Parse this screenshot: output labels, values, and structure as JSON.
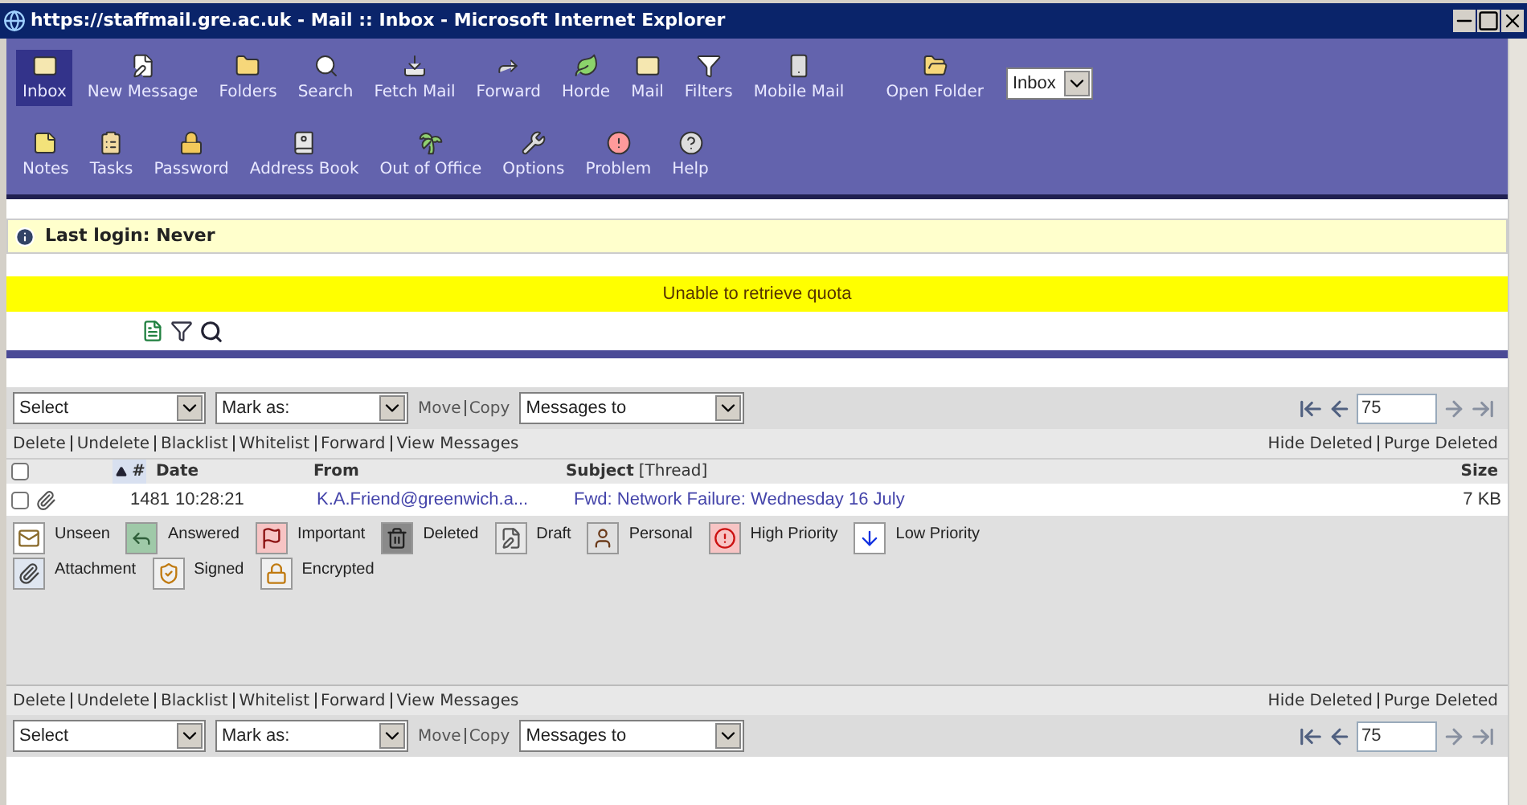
{
  "window": {
    "title": "https://staffmail.gre.ac.uk - Mail :: Inbox - Microsoft Internet Explorer"
  },
  "toolbar": {
    "main_items": [
      {
        "label": "Inbox",
        "kind": "inbox",
        "selected": true
      },
      {
        "label": "New Message",
        "kind": "compose",
        "selected": false
      },
      {
        "label": "Folders",
        "kind": "folders",
        "selected": false
      },
      {
        "label": "Search",
        "kind": "search",
        "selected": false
      },
      {
        "label": "Fetch Mail",
        "kind": "fetch",
        "selected": false
      },
      {
        "label": "Forward",
        "kind": "forward",
        "selected": false
      },
      {
        "label": "Horde",
        "kind": "horde",
        "selected": false
      },
      {
        "label": "Mail",
        "kind": "mail",
        "selected": false
      },
      {
        "label": "Filters",
        "kind": "filters",
        "selected": false
      },
      {
        "label": "Mobile Mail",
        "kind": "mobile",
        "selected": false
      }
    ],
    "app_items": [
      {
        "label": "Notes",
        "kind": "notes",
        "selected": false
      },
      {
        "label": "Tasks",
        "kind": "tasks",
        "selected": false
      },
      {
        "label": "Password",
        "kind": "password",
        "selected": false
      },
      {
        "label": "Address Book",
        "kind": "addressbook",
        "selected": false
      },
      {
        "label": "Out of Office",
        "kind": "vacation",
        "selected": false
      },
      {
        "label": "Options",
        "kind": "options",
        "selected": false
      },
      {
        "label": "Problem",
        "kind": "problem",
        "selected": false
      },
      {
        "label": "Help",
        "kind": "help",
        "selected": false
      }
    ],
    "open_folder": "Open Folder",
    "folder_select": "Inbox"
  },
  "notices": {
    "last_login": "Last login: Never",
    "quota": "Unable to retrieve quota"
  },
  "controls": [
    {
      "select": "Select",
      "mark_as": "Mark as:",
      "move": "Move",
      "copy": "Copy",
      "messages_to": "Messages to",
      "page": "75"
    },
    {
      "select": "Select",
      "mark_as": "Mark as:",
      "move": "Move",
      "copy": "Copy",
      "messages_to": "Messages to",
      "page": "75"
    }
  ],
  "action_bars": [
    {
      "actions": [
        "Delete",
        "Undelete",
        "Blacklist",
        "Whitelist",
        "Forward",
        "View Messages"
      ],
      "deleted_actions": [
        "Hide Deleted",
        "Purge Deleted"
      ]
    },
    {
      "actions": [
        "Delete",
        "Undelete",
        "Blacklist",
        "Whitelist",
        "Forward",
        "View Messages"
      ],
      "deleted_actions": [
        "Hide Deleted",
        "Purge Deleted"
      ]
    }
  ],
  "table": {
    "select_all": {
      "checked": false
    },
    "columns": {
      "number": "#",
      "date": "Date",
      "from": "From",
      "subject": "Subject",
      "thread": "[Thread]",
      "size": "Size"
    },
    "rows": [
      {
        "checked": false,
        "attachment": true,
        "number": "1481",
        "date": "10:28:21",
        "from": "K.A.Friend@greenwich.a...",
        "subject": "Fwd: Network Failure: Wednesday 16 July",
        "size": "7 KB"
      }
    ]
  },
  "legend": [
    [
      {
        "kind": "unseen",
        "label": "Unseen"
      },
      {
        "kind": "answered",
        "label": "Answered"
      },
      {
        "kind": "important",
        "label": "Important"
      },
      {
        "kind": "deleted",
        "label": "Deleted"
      },
      {
        "kind": "draft",
        "label": "Draft"
      },
      {
        "kind": "personal",
        "label": "Personal"
      },
      {
        "kind": "high",
        "label": "High Priority"
      },
      {
        "kind": "low",
        "label": "Low Priority"
      }
    ],
    [
      {
        "kind": "attachment",
        "label": "Attachment"
      },
      {
        "kind": "signed",
        "label": "Signed"
      },
      {
        "kind": "encrypted",
        "label": "Encrypted"
      }
    ]
  ]
}
